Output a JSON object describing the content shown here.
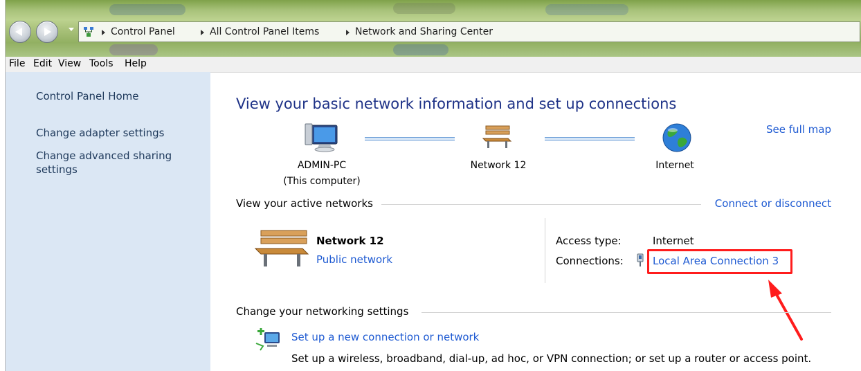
{
  "breadcrumb": [
    "Control Panel",
    "All Control Panel Items",
    "Network and Sharing Center"
  ],
  "menu": [
    "File",
    "Edit",
    "View",
    "Tools",
    "Help"
  ],
  "sidebar": {
    "home": "Control Panel Home",
    "adapter": "Change adapter settings",
    "advanced_line1": "Change advanced sharing",
    "advanced_line2": "settings"
  },
  "main": {
    "title": "View your basic network information and set up connections",
    "see_full_map": "See full map",
    "map": {
      "computer_name": "ADMIN-PC",
      "computer_sub": "(This computer)",
      "network": "Network  12",
      "internet": "Internet"
    },
    "active": {
      "heading": "View your active networks",
      "connect_link": "Connect or disconnect",
      "network_name": "Network  12",
      "network_type": "Public network",
      "access_label": "Access type:",
      "access_value": "Internet",
      "connections_label": "Connections:",
      "connection_link": "Local Area Connection 3"
    },
    "change": {
      "heading": "Change your networking settings",
      "setup_link": "Set up a new connection or network",
      "setup_desc": "Set up a wireless, broadband, dial-up, ad hoc, or VPN connection; or set up a router or access point."
    }
  },
  "colors": {
    "link": "#1e5ad2",
    "title": "#1e3287",
    "sidebar_bg": "#dbe7f4",
    "highlight": "#ff1c1c"
  }
}
